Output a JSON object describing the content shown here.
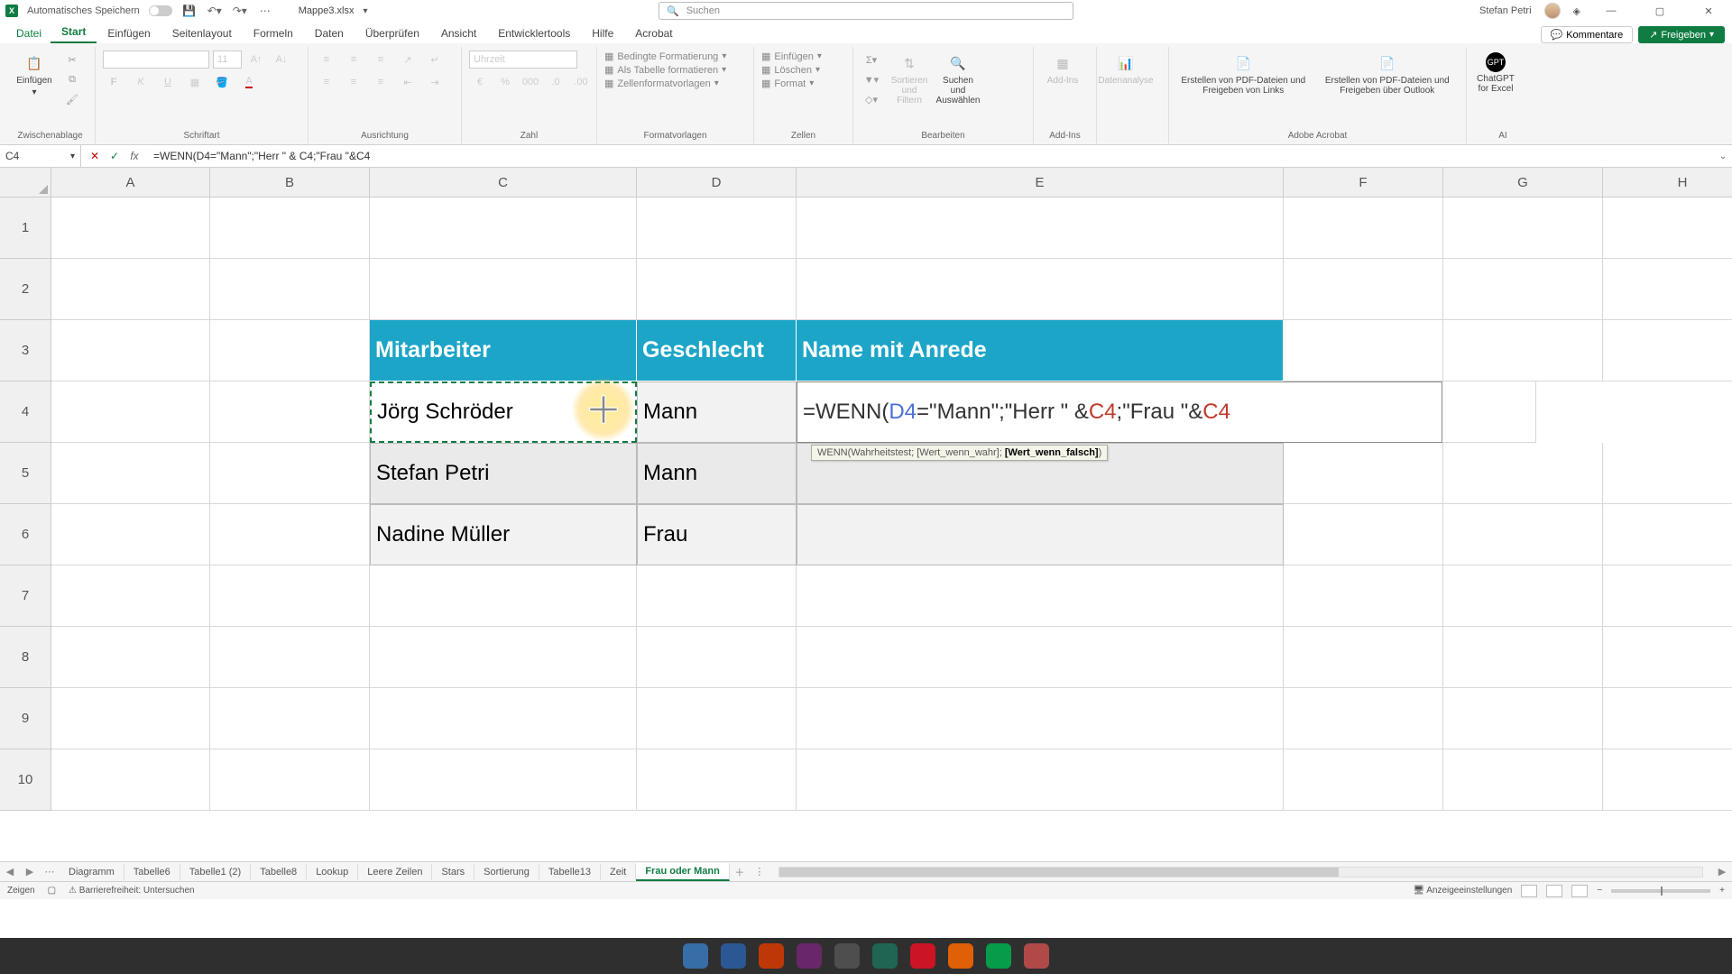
{
  "title": {
    "autosave": "Automatisches Speichern",
    "filename": "Mappe3.xlsx"
  },
  "search": {
    "placeholder": "Suchen"
  },
  "user": {
    "name": "Stefan Petri"
  },
  "tabs": {
    "file": "Datei",
    "items": [
      "Start",
      "Einfügen",
      "Seitenlayout",
      "Formeln",
      "Daten",
      "Überprüfen",
      "Ansicht",
      "Entwicklertools",
      "Hilfe",
      "Acrobat"
    ],
    "comments": "Kommentare",
    "share": "Freigeben"
  },
  "ribbon": {
    "clipboard": {
      "paste": "Einfügen",
      "label": "Zwischenablage"
    },
    "font": {
      "label": "Schriftart",
      "size": "11"
    },
    "align": {
      "label": "Ausrichtung"
    },
    "number": {
      "label": "Zahl",
      "format": "Uhrzeit"
    },
    "styles": {
      "cond": "Bedingte Formatierung",
      "table": "Als Tabelle formatieren",
      "cell": "Zellenformatvorlagen",
      "label": "Formatvorlagen"
    },
    "cells": {
      "insert": "Einfügen",
      "delete": "Löschen",
      "format": "Format",
      "label": "Zellen"
    },
    "editing": {
      "sort": "Sortieren und Filtern",
      "find": "Suchen und Auswählen",
      "label": "Bearbeiten"
    },
    "addins": {
      "addins": "Add-Ins",
      "label": "Add-Ins"
    },
    "analysis": {
      "btn": "Datenanalyse",
      "label": ""
    },
    "acrobat": {
      "left": "Erstellen von PDF-Dateien und Freigeben von Links",
      "right": "Erstellen von PDF-Dateien und Freigeben über Outlook",
      "label": "Adobe Acrobat"
    },
    "ai": {
      "btn": "ChatGPT for Excel",
      "label": "AI"
    }
  },
  "formulabar": {
    "namebox": "C4",
    "formula": "=WENN(D4=\"Mann\";\"Herr \" & C4;\"Frau \"&C4"
  },
  "cols": [
    "A",
    "B",
    "C",
    "D",
    "E",
    "F",
    "G",
    "H"
  ],
  "rows": [
    "1",
    "2",
    "3",
    "4",
    "5",
    "6",
    "7",
    "8",
    "9",
    "10"
  ],
  "table": {
    "headers": {
      "c": "Mitarbeiter",
      "d": "Geschlecht",
      "e": "Name mit Anrede"
    },
    "r4": {
      "c": "Jörg Schröder",
      "d": "Mann"
    },
    "r5": {
      "c": "Stefan Petri",
      "d": "Mann"
    },
    "r6": {
      "c": "Nadine Müller",
      "d": "Frau"
    }
  },
  "editformula": {
    "p1": "=WENN(",
    "d4": "D4",
    "p2": "=\"Mann\";\"Herr \" & ",
    "c4a": "C4",
    "p3": ";\"Frau \"&",
    "c4b": "C4"
  },
  "tooltip": {
    "fn": "WENN(",
    "a1": "Wahrheitstest; ",
    "a2": "[Wert_wenn_wahr]; ",
    "a3": "[Wert_wenn_falsch]",
    "end": ")"
  },
  "sheets": [
    "Diagramm",
    "Tabelle6",
    "Tabelle1 (2)",
    "Tabelle8",
    "Lookup",
    "Leere Zeilen",
    "Stars",
    "Sortierung",
    "Tabelle13",
    "Zeit",
    "Frau oder Mann"
  ],
  "status": {
    "mode": "Zeigen",
    "access": "Barrierefreiheit: Untersuchen",
    "display": "Anzeigeeinstellungen"
  }
}
